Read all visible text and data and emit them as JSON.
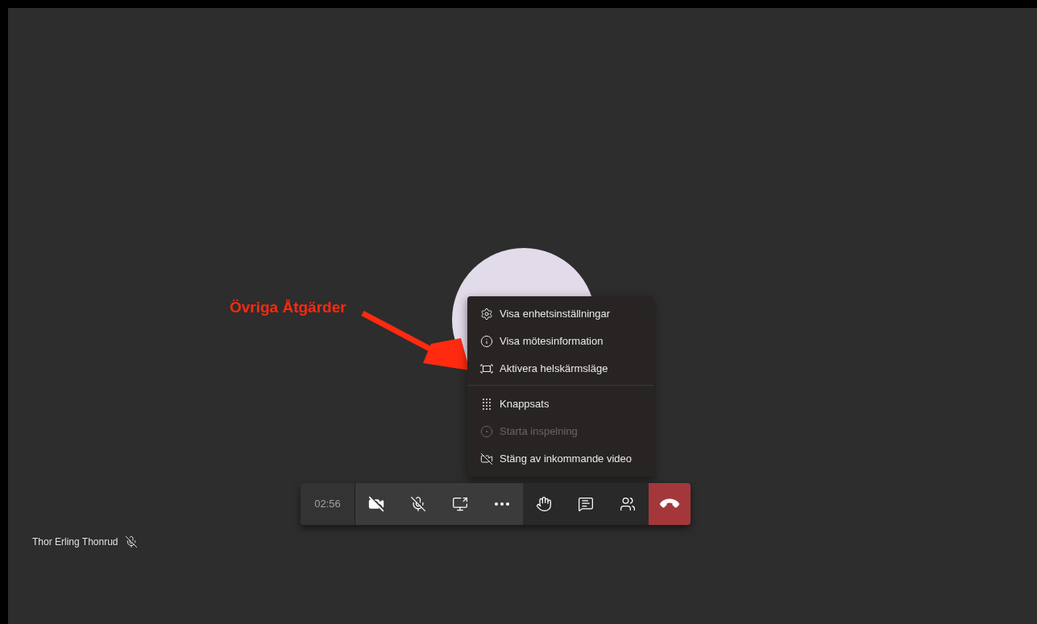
{
  "annotation": {
    "label": "Övriga Åtgärder"
  },
  "menu": {
    "groups": [
      [
        {
          "kind": "settings",
          "label": "Visa enhetsinställningar",
          "disabled": false
        },
        {
          "kind": "info",
          "label": "Visa mötesinformation",
          "disabled": false
        },
        {
          "kind": "fullscreen",
          "label": "Aktivera helskärmsläge",
          "disabled": false
        }
      ],
      [
        {
          "kind": "keypad",
          "label": "Knappsats",
          "disabled": false
        },
        {
          "kind": "record",
          "label": "Starta inspelning",
          "disabled": true
        },
        {
          "kind": "videooff",
          "label": "Stäng av inkommande video",
          "disabled": false
        }
      ]
    ]
  },
  "toolbar": {
    "timer": "02:56",
    "camera_on": false,
    "mic_muted": true
  },
  "participant": {
    "name": "Thor Erling Thonrud",
    "mic_muted": true
  }
}
